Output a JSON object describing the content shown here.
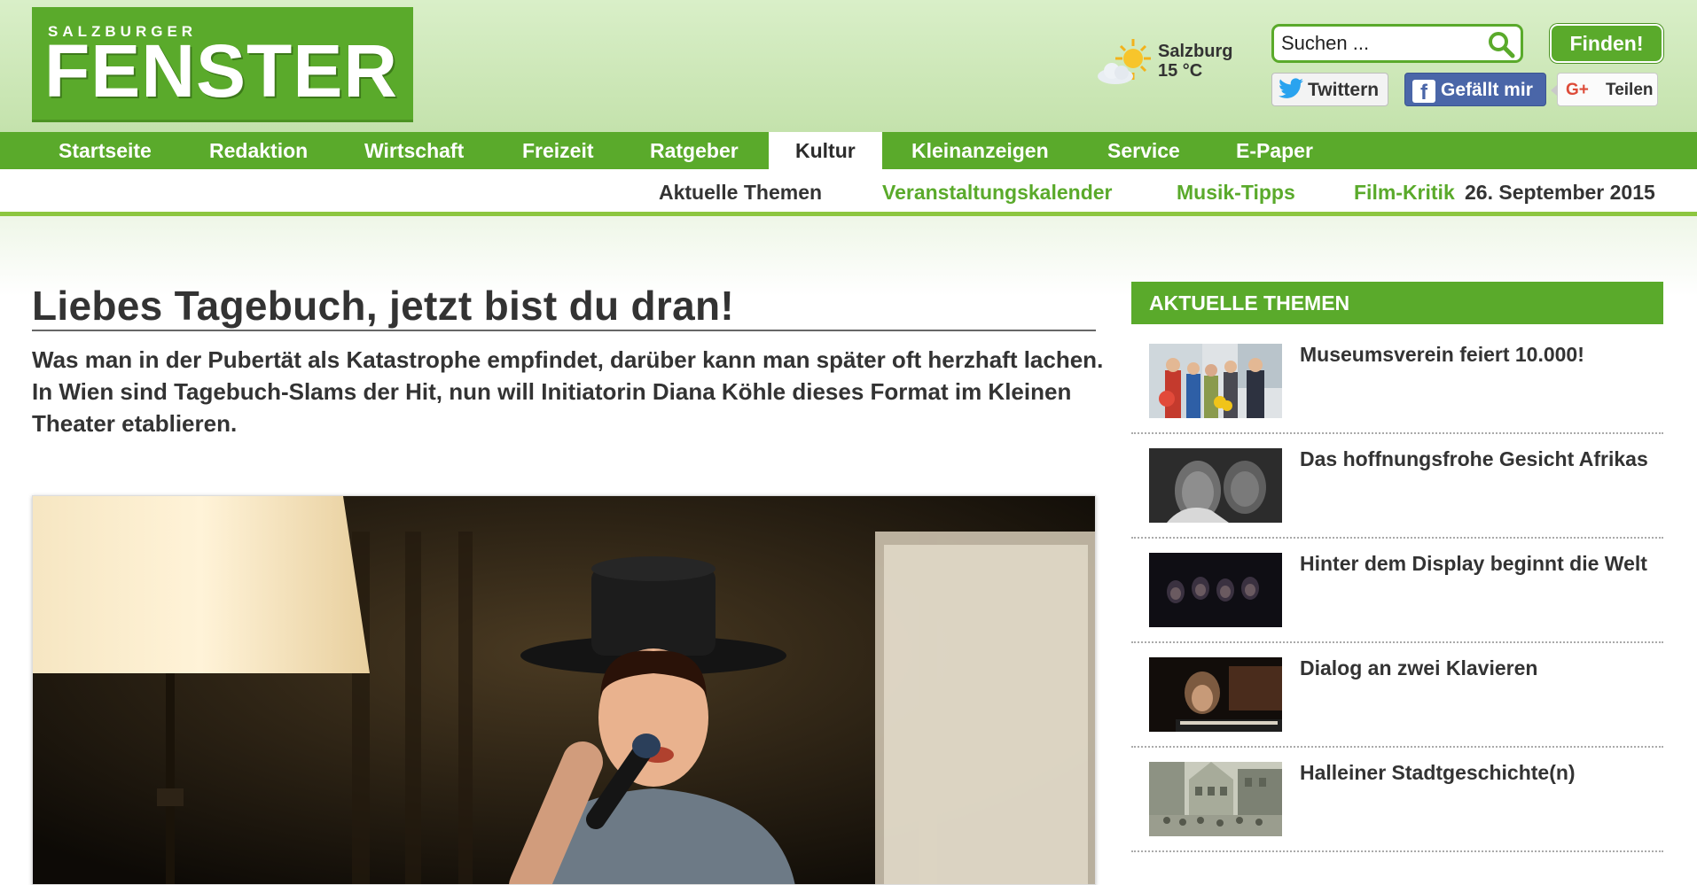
{
  "header": {
    "logo_top": "SALZBURGER",
    "logo_main": "FENSTER",
    "weather": {
      "city": "Salzburg",
      "temp": "15 °C",
      "icon": "sun-cloud-icon"
    },
    "search": {
      "placeholder": "Suchen ...",
      "button": "Finden!"
    },
    "social": {
      "twitter": "Twittern",
      "facebook": "Gefällt mir",
      "gplus_mark": "G+",
      "gplus": "Teilen"
    }
  },
  "mainnav": [
    "Startseite",
    "Redaktion",
    "Wirtschaft",
    "Freizeit",
    "Ratgeber",
    "Kultur",
    "Kleinanzeigen",
    "Service",
    "E-Paper"
  ],
  "subnav": {
    "items": [
      "Aktuelle Themen",
      "Veranstaltungskalender",
      "Musik-Tipps",
      "Film-Kritik"
    ],
    "date": "26. September 2015"
  },
  "article": {
    "headline": "Liebes Tagebuch, jetzt bist du dran!",
    "lead": "Was man in der Pubertät als Katastrophe empfindet, darüber kann man später oft herzhaft lachen. In Wien sind Tagebuch-Slams der Hit, nun will Initiatorin Diana Köhle dieses Format im Kleinen Theater etablieren."
  },
  "sidebar": {
    "heading": "AKTUELLE THEMEN",
    "items": [
      {
        "title": "Museumsverein feiert 10.000!"
      },
      {
        "title": "Das hoffnungsfrohe Gesicht Afrikas"
      },
      {
        "title": "Hinter dem Display beginnt die Welt"
      },
      {
        "title": "Dialog an zwei Klavieren"
      },
      {
        "title": "Halleiner Stadtgeschichte(n)"
      }
    ]
  },
  "colors": {
    "brand_green": "#5aaa2b",
    "header_bg": "#d2ebbd",
    "accent_green": "#8cc63f"
  }
}
